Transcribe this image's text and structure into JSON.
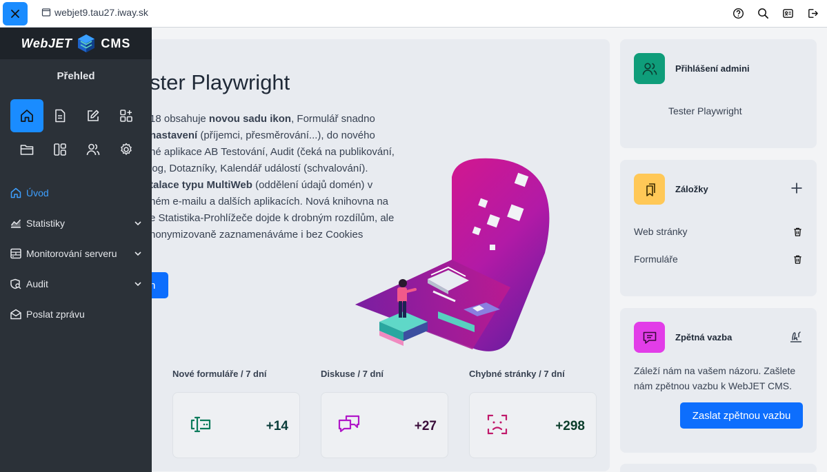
{
  "browser": {
    "url": "webjet9.tau27.iway.sk"
  },
  "sidebar": {
    "logo_left": "WebJET",
    "logo_right": "CMS",
    "section_title": "Přehled",
    "menu": [
      {
        "label": "Úvod"
      },
      {
        "label": "Statistiky"
      },
      {
        "label": "Monitorování serveru"
      },
      {
        "label": "Audit"
      },
      {
        "label": "Poslat zprávu"
      }
    ]
  },
  "hero": {
    "title": "ster Playwright",
    "lines": [
      [
        "18 obsahuje ",
        "novou sadu ikon",
        ", Formulář snadno"
      ],
      [
        "",
        "nastavení",
        " (příjemci, přesměrování...), do nového"
      ],
      [
        "né aplikace AB Testování, Audit (čeká na publikování,",
        "",
        ""
      ],
      [
        "log, Dotazníky, Kalendář událostí (schvalování).",
        "",
        ""
      ],
      [
        "",
        "talace typu MultiWeb",
        " (oddělení údajů domén) v"
      ],
      [
        "ném e-mailu a dalších aplikacích. Nová knihovna na",
        "",
        ""
      ],
      [
        "e Statistika-Prohlížeče dojde k drobným rozdílům, ale",
        "",
        ""
      ],
      [
        "nonymizovaně zaznamenáváme i bez Cookies",
        "",
        ""
      ]
    ],
    "button_label": "n"
  },
  "stats": [
    {
      "label": "Nové formuláře / 7 dní",
      "value": "+14"
    },
    {
      "label": "Diskuse / 7 dní",
      "value": "+27"
    },
    {
      "label": "Chybné stránky / 7 dní",
      "value": "+298"
    }
  ],
  "cards": {
    "admins": {
      "title": "Přihlášení admini",
      "name": "Tester Playwright"
    },
    "bookmarks": {
      "title": "Záložky",
      "items": [
        "Web stránky",
        "Formuláře"
      ]
    },
    "feedback": {
      "title": "Zpětná vazba",
      "text": "Záleží nám na vašem názoru. Zašlete nám zpětnou vazbu k WebJET CMS.",
      "button": "Zaslat zpětnou vazbu"
    }
  },
  "colors": {
    "accent": "#1a8cff",
    "sidebar": "#2b3138",
    "admin_badge": "#0f9d7a",
    "bookmark_badge": "#ffc857",
    "feedback_badge": "#e23de8",
    "stat_forms": "#0a7a5a",
    "stat_disc": "#b016c8",
    "stat_err": "#c0186a"
  }
}
